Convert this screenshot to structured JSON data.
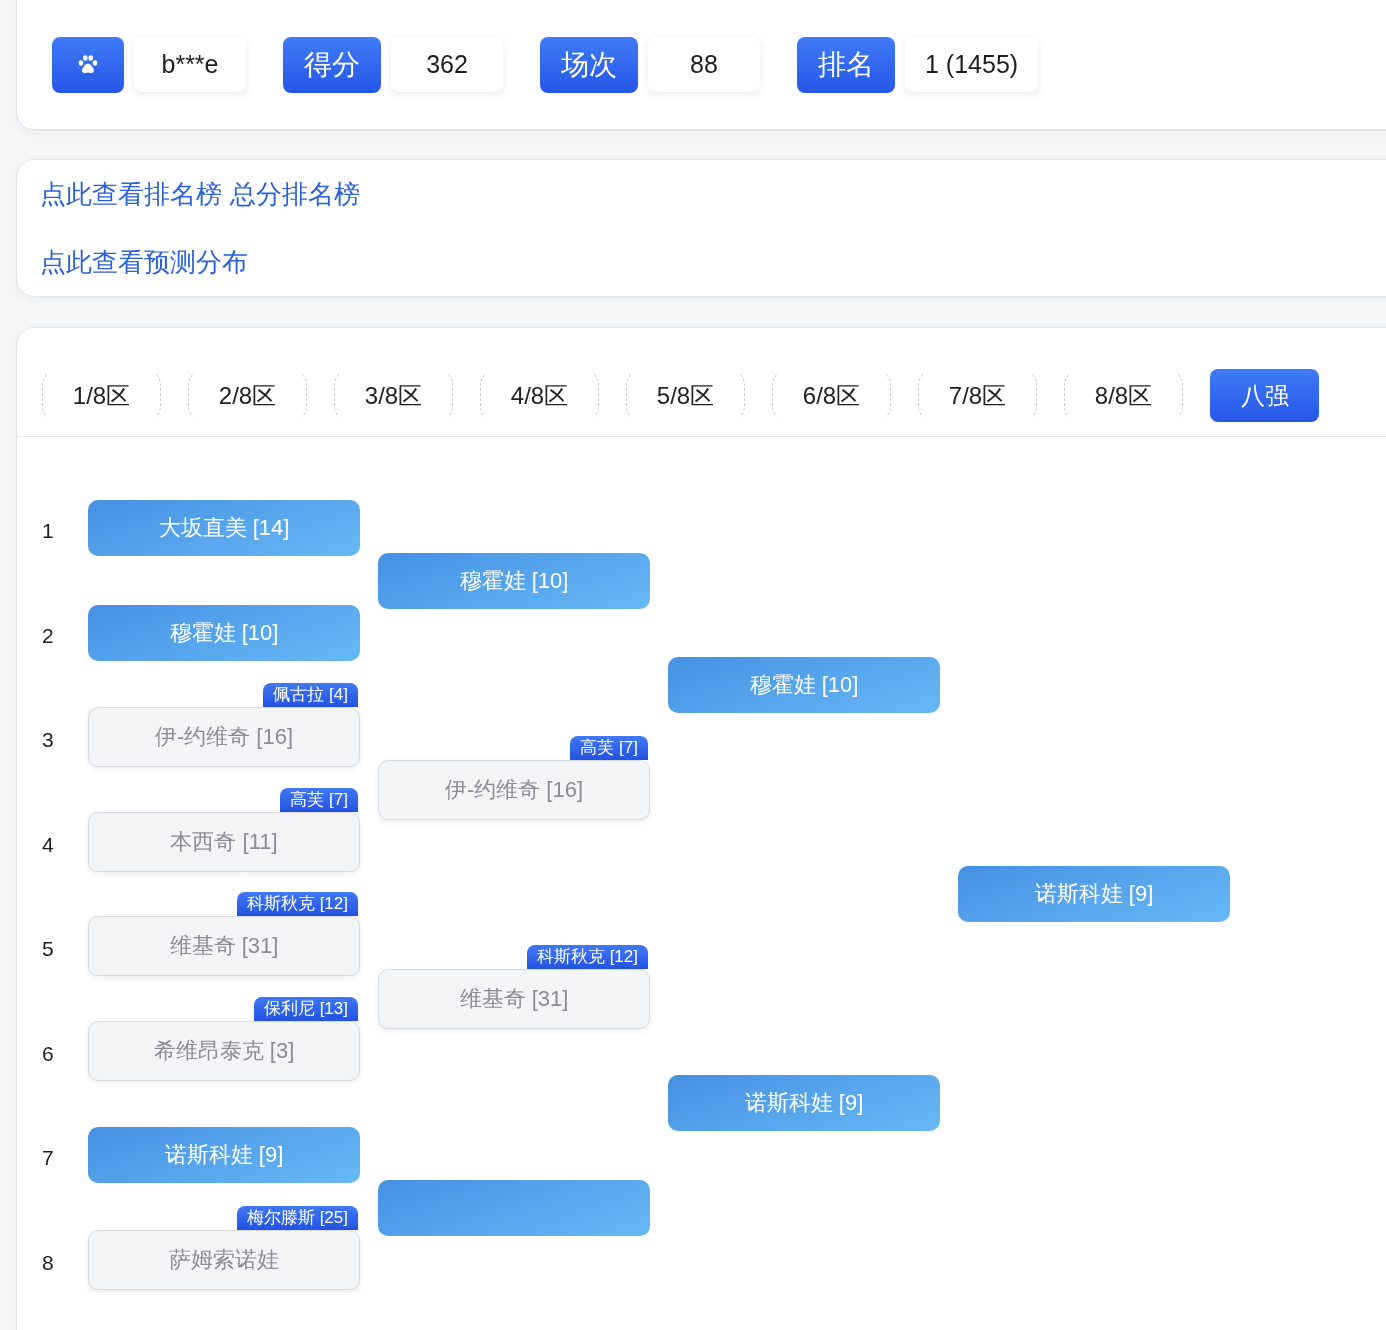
{
  "user": {
    "name": "b***e"
  },
  "stats": [
    {
      "label": "得分",
      "value": "362"
    },
    {
      "label": "场次",
      "value": "88"
    },
    {
      "label": "排名",
      "value": "1 (1455)"
    }
  ],
  "link_rows": [
    [
      "点此查看排名榜",
      "总分排名榜"
    ],
    [
      "点此查看预测分布"
    ]
  ],
  "tabs": [
    {
      "label": "1/8区",
      "selected": false
    },
    {
      "label": "2/8区",
      "selected": false
    },
    {
      "label": "3/8区",
      "selected": false
    },
    {
      "label": "4/8区",
      "selected": false
    },
    {
      "label": "5/8区",
      "selected": false
    },
    {
      "label": "6/8区",
      "selected": false
    },
    {
      "label": "7/8区",
      "selected": false
    },
    {
      "label": "8/8区",
      "selected": false
    },
    {
      "label": "八强",
      "selected": true
    }
  ],
  "bracket": {
    "seeds": [
      "1",
      "2",
      "3",
      "4",
      "5",
      "6",
      "7",
      "8"
    ],
    "rounds": [
      [
        {
          "name": "大坂直美 [14]",
          "correct": true
        },
        {
          "name": "穆霍娃 [10]",
          "correct": true
        },
        {
          "name": "伊-约维奇 [16]",
          "correct": false,
          "actual": "佩古拉 [4]"
        },
        {
          "name": "本西奇 [11]",
          "correct": false,
          "actual": "高芙 [7]"
        },
        {
          "name": "维基奇 [31]",
          "correct": false,
          "actual": "科斯秋克 [12]"
        },
        {
          "name": "希维昂泰克 [3]",
          "correct": false,
          "actual": "保利尼 [13]"
        },
        {
          "name": "诺斯科娃 [9]",
          "correct": true
        },
        {
          "name": "萨姆索诺娃",
          "correct": false,
          "actual": "梅尔滕斯 [25]"
        }
      ],
      [
        {
          "name": "穆霍娃 [10]",
          "correct": true
        },
        {
          "name": "伊-约维奇 [16]",
          "correct": false,
          "actual": "高芙 [7]"
        },
        {
          "name": "维基奇 [31]",
          "correct": false,
          "actual": "科斯秋克 [12]"
        },
        {
          "correct": true
        }
      ],
      [
        {
          "name": "穆霍娃 [10]",
          "correct": true
        },
        {
          "name": "诺斯科娃 [9]",
          "correct": true
        }
      ],
      [
        {
          "name": "诺斯科娃 [9]",
          "correct": true
        }
      ]
    ]
  }
}
